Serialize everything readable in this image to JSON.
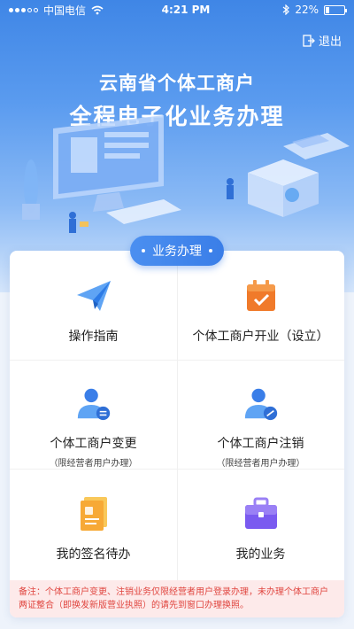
{
  "status_bar": {
    "carrier": "中国电信",
    "time": "4:21 PM",
    "battery": "22%"
  },
  "header": {
    "logout_label": "退出",
    "title_line1": "云南省个体工商户",
    "title_line2": "全程电子化业务办理"
  },
  "section": {
    "badge_label": "业务办理"
  },
  "services": [
    {
      "label": "操作指南",
      "sub": ""
    },
    {
      "label": "个体工商户开业（设立）",
      "sub": ""
    },
    {
      "label": "个体工商户变更",
      "sub": "（限经营者用户办理）"
    },
    {
      "label": "个体工商户注销",
      "sub": "（限经营者用户办理）"
    },
    {
      "label": "我的签名待办",
      "sub": ""
    },
    {
      "label": "我的业务",
      "sub": ""
    }
  ],
  "footer_note": "备注：个体工商户变更、注销业务仅限经营者用户登录办理，未办理个体工商户两证整合（即换发新版营业执照）的请先到窗口办理换照。",
  "colors": {
    "primary": "#3a7ee8",
    "orange": "#f07a2a",
    "purple": "#7a5af0",
    "note_red": "#e0453f"
  }
}
